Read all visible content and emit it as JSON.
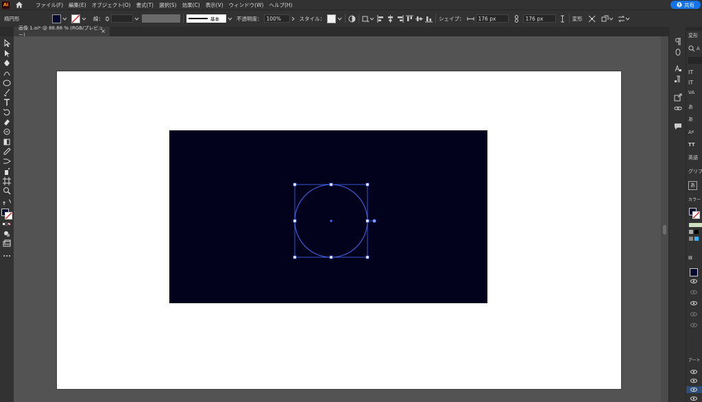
{
  "app": {
    "logo_text": "Ai"
  },
  "menu": [
    "ファイル(F)",
    "編集(E)",
    "オブジェクト(O)",
    "書式(T)",
    "選択(S)",
    "効果(C)",
    "表示(V)",
    "ウィンドウ(W)",
    "ヘルプ(H)"
  ],
  "share_label": "共有",
  "control": {
    "object_type": "楕円形",
    "stroke_label": "線：",
    "stroke_profile": "基本",
    "opacity_label": "不透明度：",
    "opacity_value": "100%",
    "style_label": "スタイル：",
    "shape_label": "シェイプ：",
    "width_value": "176 px",
    "height_value": "176 px",
    "transform_label": "変形"
  },
  "document": {
    "tab_title": "画像 1.ai* @ 88.88 % (RGB/プレビュー)",
    "close": "×"
  },
  "right_panel": {
    "header": "変形",
    "properties_label": "A",
    "lang": "英語",
    "glyph": "グリフ",
    "color_label": "カラー",
    "layers_label": "線",
    "artboards_label": "アート"
  },
  "colors": {
    "artwork_fill": "#02021c",
    "selection": "#4a6cff",
    "fill_swatch": "#050a2e"
  }
}
